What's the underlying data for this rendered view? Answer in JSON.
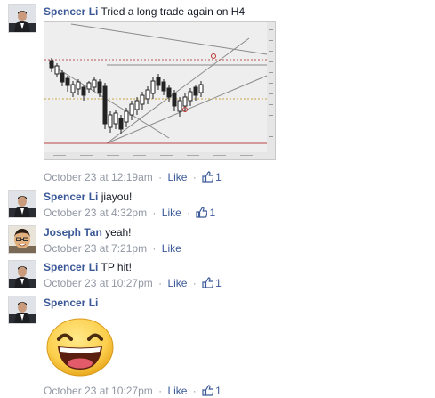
{
  "comments": [
    {
      "author": "Spencer Li",
      "text": "Tried a long trade again on H4",
      "time": "October 23 at 12:19am",
      "like_label": "Like",
      "like_count": "1",
      "avatar": "man-in-dark-suit"
    },
    {
      "author": "Spencer Li",
      "text": "jiayou!",
      "time": "October 23 at 4:32pm",
      "like_label": "Like",
      "like_count": "1",
      "avatar": "man-in-dark-suit"
    },
    {
      "author": "Joseph Tan",
      "text": "yeah!",
      "time": "October 23 at 7:21pm",
      "like_label": "Like",
      "avatar": "man-with-glasses"
    },
    {
      "author": "Spencer Li",
      "text": "TP hit!",
      "time": "October 23 at 10:27pm",
      "like_label": "Like",
      "like_count": "1",
      "avatar": "man-in-dark-suit"
    },
    {
      "author": "Spencer Li",
      "text": "",
      "time": "October 23 at 10:27pm",
      "like_label": "Like",
      "like_count": "1",
      "avatar": "man-in-dark-suit",
      "sticker": "laughing-smiley-sticker"
    }
  ],
  "separator": "·",
  "colors": {
    "link": "#3b5998",
    "meta": "#9197a3",
    "text": "#141823",
    "chart_bg": "#eeeeee"
  }
}
